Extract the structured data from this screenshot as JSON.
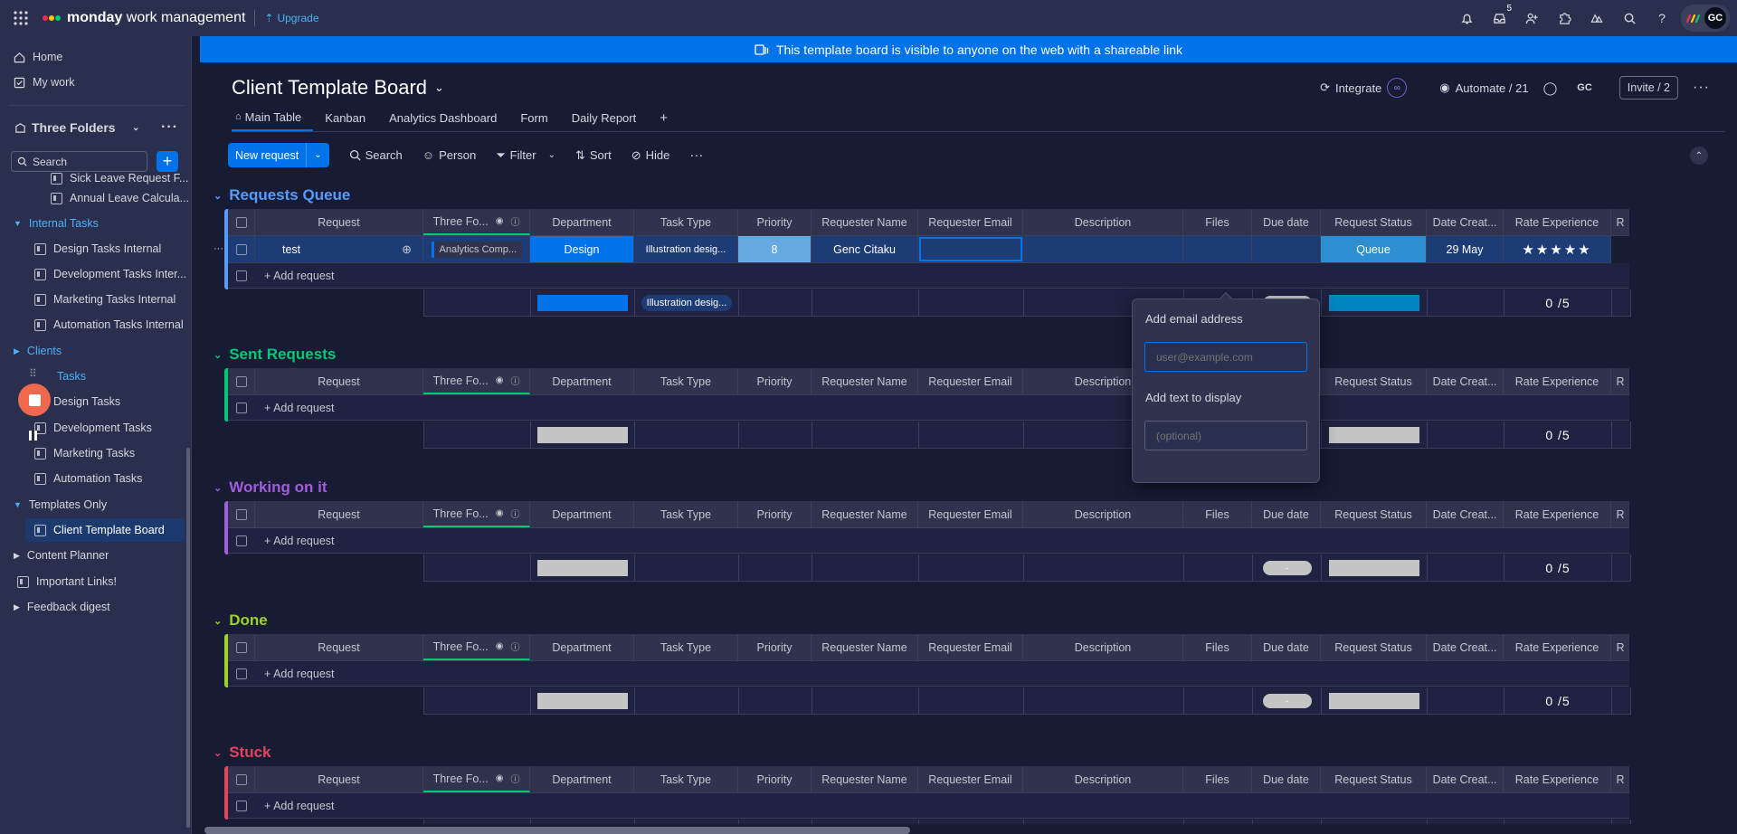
{
  "topbar": {
    "brand_bold": "monday",
    "brand_rest": " work management",
    "upgrade": "Upgrade",
    "inbox_badge": "5",
    "avatar": "GC"
  },
  "sidebar": {
    "home": "Home",
    "my_work": "My work",
    "workspace": "Three Folders",
    "search_placeholder": "Search",
    "items": [
      "Sick Leave Request F...",
      "Annual Leave Calcula...",
      "Internal Tasks",
      "Design Tasks Internal",
      "Development Tasks Inter...",
      "Marketing Tasks Internal",
      "Automation Tasks Internal",
      "Clients",
      "Tasks",
      "Design Tasks",
      "Development Tasks",
      "Marketing Tasks",
      "Automation Tasks",
      "Templates Only",
      "Client Template Board",
      "Content Planner",
      "Important Links!",
      "Feedback digest"
    ]
  },
  "banner": "This template board is visible to anyone on the web with a shareable link",
  "board": {
    "title": "Client Template Board",
    "integrate": "Integrate",
    "automate": "Automate / 21",
    "avatar": "GC",
    "invite": "Invite / 2",
    "tabs": [
      "Main Table",
      "Kanban",
      "Analytics Dashboard",
      "Form",
      "Daily Report"
    ],
    "toolbar": {
      "new_request": "New request",
      "search": "Search",
      "person": "Person",
      "filter": "Filter",
      "sort": "Sort",
      "hide": "Hide"
    }
  },
  "columns": [
    "Request",
    "Three Fo...",
    "Department",
    "Task Type",
    "Priority",
    "Requester Name",
    "Requester Email",
    "Description",
    "Files",
    "Due date",
    "Request Status",
    "Date Creat...",
    "Rate Experience"
  ],
  "groups": [
    {
      "name": "Requests Queue",
      "color": "#579bfc"
    },
    {
      "name": "Sent Requests",
      "color": "#00c875"
    },
    {
      "name": "Working on it",
      "color": "#a25ddc"
    },
    {
      "name": "Done",
      "color": "#9cd326"
    },
    {
      "name": "Stuck",
      "color": "#e2445c"
    }
  ],
  "item_row": {
    "name": "test",
    "three_folders": "Analytics Comp...",
    "department": "Design",
    "task_type": "Illustration desig...",
    "priority": "8",
    "requester_name": "Genc Citaku",
    "status": "Queue",
    "date_created": "29 May",
    "stars": "★★★★★"
  },
  "summary": {
    "task_type": "Illustration desig...",
    "rating": "0 /5",
    "add_request": "+ Add request"
  },
  "popup": {
    "email_label": "Add email address",
    "email_placeholder": "user@example.com",
    "text_label": "Add text to display",
    "text_placeholder": "(optional)"
  },
  "colors": {
    "accent": "#0073ea",
    "department_blue": "#0073ea",
    "status_queue": "#2d8fd0",
    "priority_blue": "#66a8e0"
  }
}
